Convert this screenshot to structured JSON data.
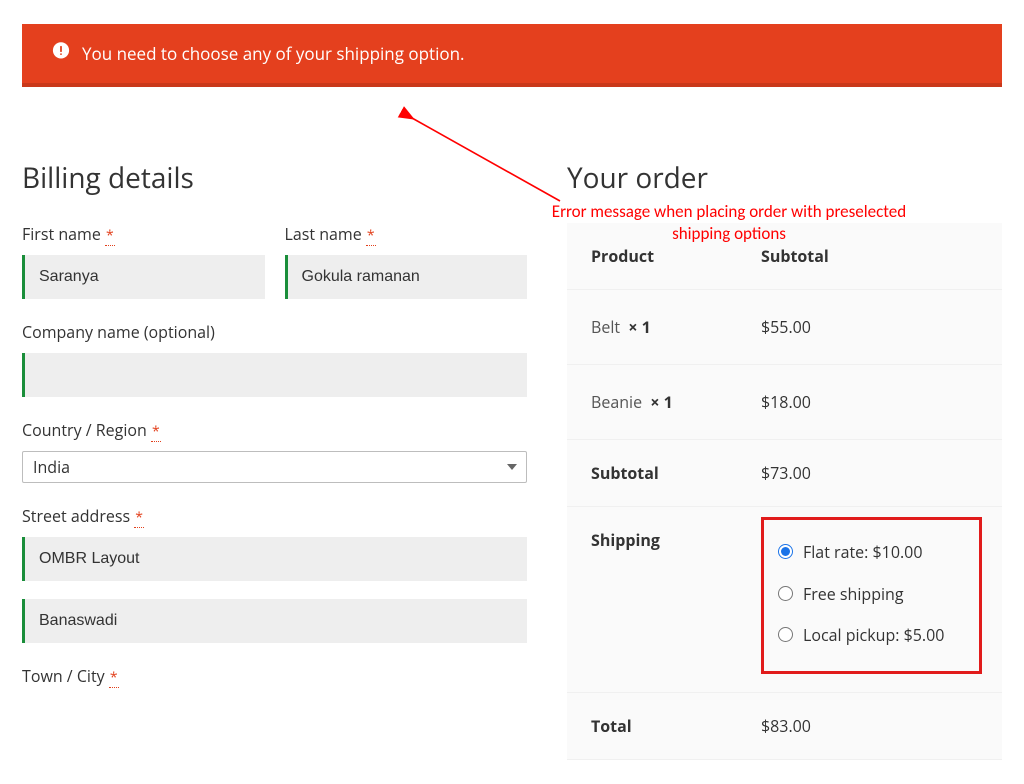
{
  "error": {
    "message": "You need to choose any of your shipping option."
  },
  "annotation": {
    "text_l1": "Error message when placing order with preselected",
    "text_l2": "shipping options"
  },
  "billing": {
    "title": "Billing details",
    "first_name": {
      "label": "First name",
      "value": "Saranya",
      "required": true
    },
    "last_name": {
      "label": "Last name",
      "value": "Gokula ramanan",
      "required": true
    },
    "company": {
      "label": "Company name (optional)",
      "value": ""
    },
    "country": {
      "label": "Country / Region",
      "value": "India",
      "required": true
    },
    "street_label": "Street address",
    "street1": "OMBR Layout",
    "street2": "Banaswadi",
    "street_required": true,
    "city": {
      "label": "Town / City",
      "required": true
    }
  },
  "order": {
    "title": "Your order",
    "header": {
      "product": "Product",
      "subtotal": "Subtotal"
    },
    "items": [
      {
        "name": "Belt",
        "qty_text": "× 1",
        "subtotal": "$55.00"
      },
      {
        "name": "Beanie",
        "qty_text": "× 1",
        "subtotal": "$18.00"
      }
    ],
    "subtotal": {
      "label": "Subtotal",
      "value": "$73.00"
    },
    "shipping": {
      "label": "Shipping",
      "options": [
        {
          "label": "Flat rate: $10.00",
          "selected": true
        },
        {
          "label": "Free shipping",
          "selected": false
        },
        {
          "label": "Local pickup: $5.00",
          "selected": false
        }
      ]
    },
    "total": {
      "label": "Total",
      "value": "$83.00"
    }
  },
  "required_marker": "*"
}
